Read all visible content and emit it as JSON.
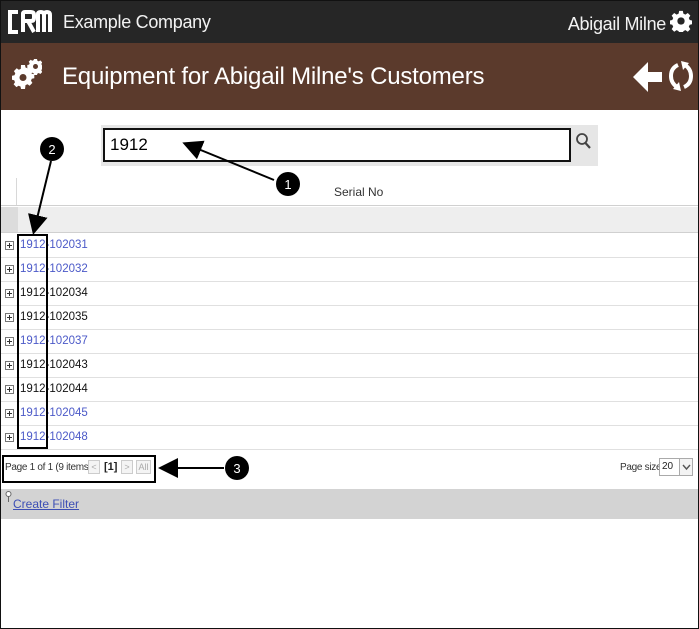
{
  "topbar": {
    "logo_text": "CRM",
    "company": "Example Company",
    "user_name": "Abigail Milne"
  },
  "titlebar": {
    "title": "Equipment for Abigail Milne's Customers"
  },
  "search": {
    "value": "1912",
    "icon": "magnifier"
  },
  "grid": {
    "columns": [
      "Serial No"
    ],
    "rows": [
      {
        "serial": "1912-102031",
        "link": true
      },
      {
        "serial": "1912-102032",
        "link": true
      },
      {
        "serial": "1912-102034",
        "link": false
      },
      {
        "serial": "1912-102035",
        "link": false
      },
      {
        "serial": "1912-102037",
        "link": true
      },
      {
        "serial": "1912-102043",
        "link": false
      },
      {
        "serial": "1912-102044",
        "link": false
      },
      {
        "serial": "1912-102045",
        "link": true
      },
      {
        "serial": "1912-102048",
        "link": true
      }
    ]
  },
  "pager": {
    "info": "Page 1 of 1 (9 items)",
    "prev": "<",
    "current": "[1]",
    "next": ">",
    "all": "All",
    "page_size_label": "Page size:",
    "page_size": "20"
  },
  "footer": {
    "create_filter": "Create Filter"
  },
  "annotations": {
    "callout_1": "1",
    "callout_2": "2",
    "callout_3": "3"
  },
  "colors": {
    "topbar": "#262626",
    "titlebar": "#5b3a2c",
    "link": "#4b59c8"
  }
}
